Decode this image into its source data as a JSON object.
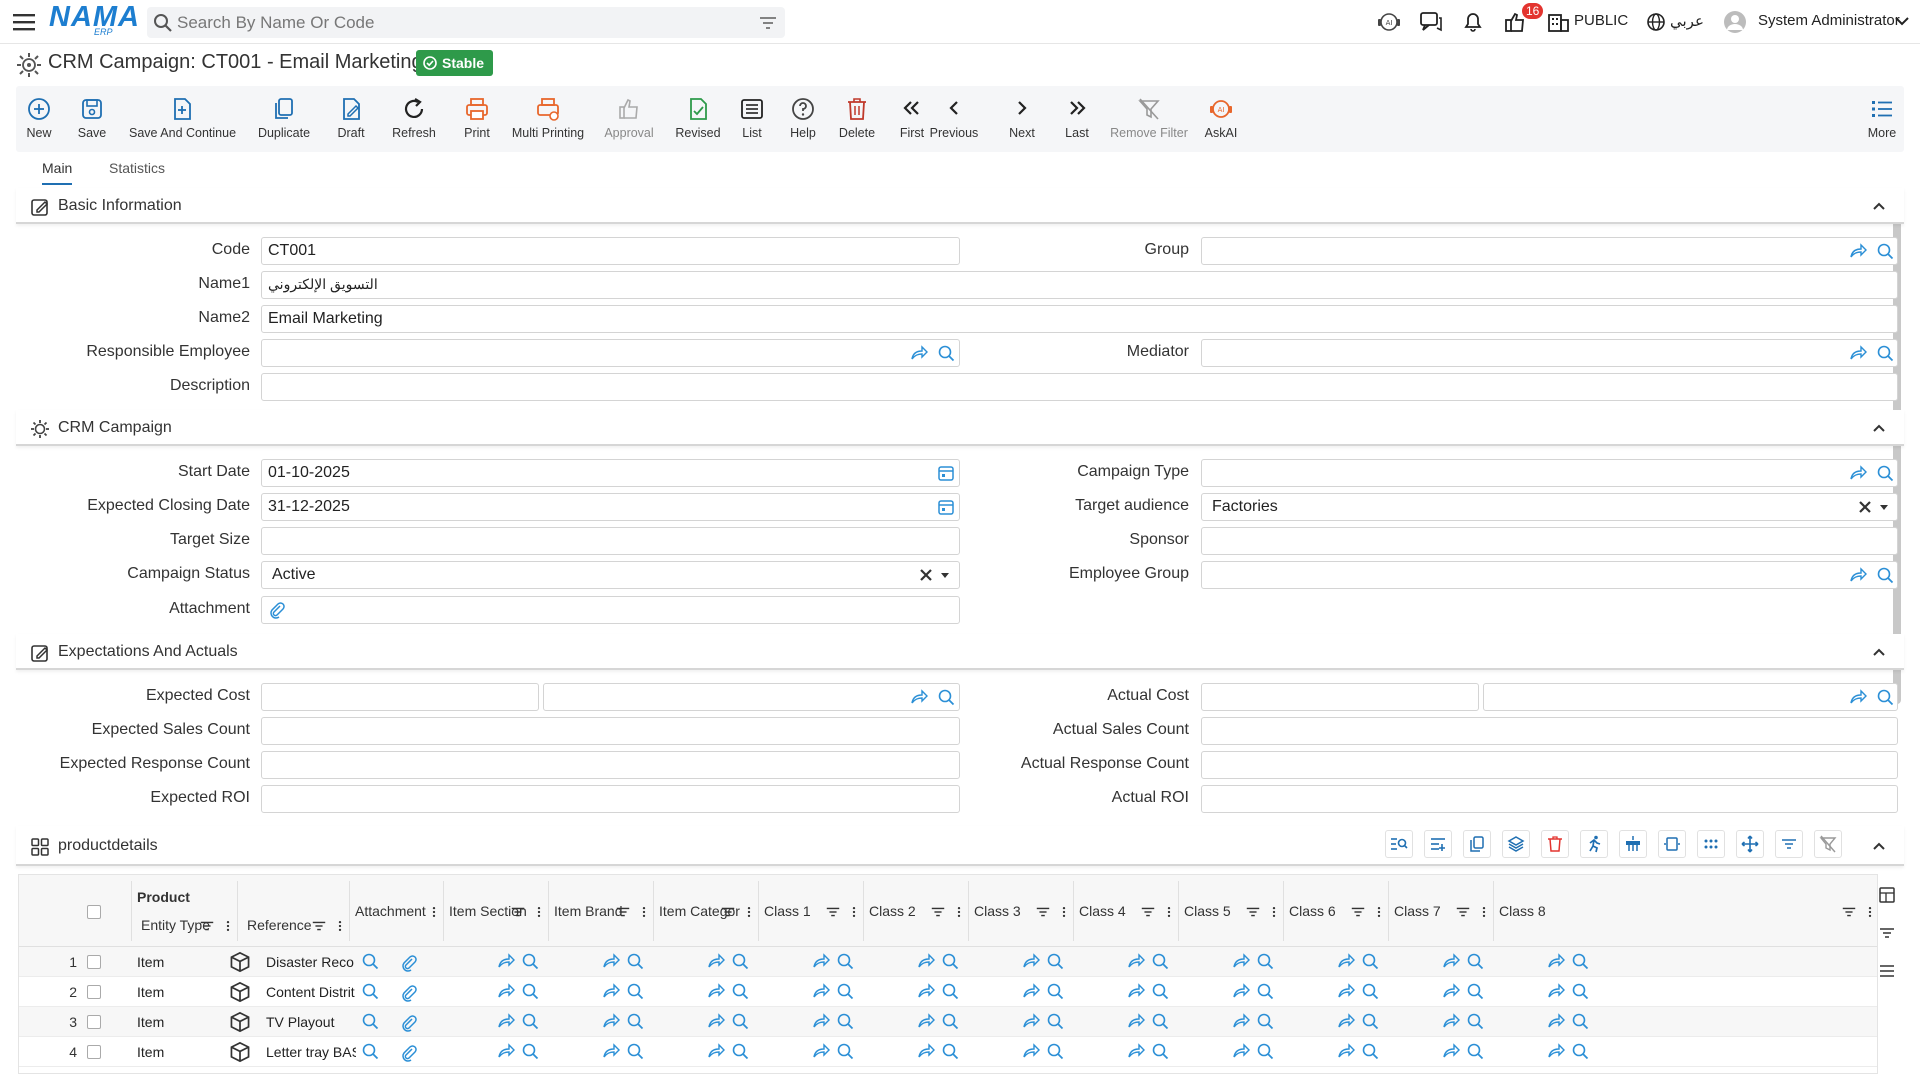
{
  "app": {
    "logo_text": "NAMA",
    "logo_sub": "ERP",
    "search_placeholder": "Search By Name Or Code",
    "notification_count": "16",
    "branch": "PUBLIC",
    "language": "عربي",
    "user": "System Administrator"
  },
  "page": {
    "title": "CRM Campaign: CT001 - Email Marketing",
    "status": "Stable"
  },
  "toolbar": {
    "new": "New",
    "save": "Save",
    "save_continue": "Save And Continue",
    "duplicate": "Duplicate",
    "draft": "Draft",
    "refresh": "Refresh",
    "print": "Print",
    "multi_printing": "Multi Printing",
    "approval": "Approval",
    "revised": "Revised",
    "list": "List",
    "help": "Help",
    "delete": "Delete",
    "first": "First",
    "previous": "Previous",
    "next": "Next",
    "last": "Last",
    "remove_filter": "Remove Filter",
    "askai": "AskAI",
    "more": "More"
  },
  "tabs": {
    "main": "Main",
    "statistics": "Statistics"
  },
  "basic": {
    "title": "Basic Information",
    "code_label": "Code",
    "code": "CT001",
    "group_label": "Group",
    "name1_label": "Name1",
    "name1": "التسويق الإلكتروني",
    "name2_label": "Name2",
    "name2": "Email Marketing",
    "resp_label": "Responsible Employee",
    "mediator_label": "Mediator",
    "desc_label": "Description"
  },
  "campaign": {
    "title": "CRM Campaign",
    "start_label": "Start Date",
    "start": "01-10-2025",
    "type_label": "Campaign Type",
    "closing_label": "Expected Closing Date",
    "closing": "31-12-2025",
    "audience_label": "Target audience",
    "audience": "Factories",
    "size_label": "Target Size",
    "sponsor_label": "Sponsor",
    "status_label": "Campaign Status",
    "status": "Active",
    "empgroup_label": "Employee Group",
    "attach_label": "Attachment"
  },
  "expect": {
    "title": "Expectations And Actuals",
    "exp_cost": "Expected Cost",
    "act_cost": "Actual Cost",
    "exp_sales": "Expected Sales Count",
    "act_sales": "Actual Sales Count",
    "exp_resp": "Expected Response Count",
    "act_resp": "Actual Response Count",
    "exp_roi": "Expected ROI",
    "act_roi": "Actual ROI"
  },
  "grid": {
    "title": "productdetails",
    "group_header": "Product",
    "columns": [
      "Entity Type",
      "Reference",
      "Attachment",
      "Item Section",
      "Item Brand",
      "Item Categor",
      "Class 1",
      "Class 2",
      "Class 3",
      "Class 4",
      "Class 5",
      "Class 6",
      "Class 7",
      "Class 8"
    ],
    "rows": [
      {
        "num": "1",
        "type": "Item",
        "ref": "Disaster Reco"
      },
      {
        "num": "2",
        "type": "Item",
        "ref": "Content Distrit"
      },
      {
        "num": "3",
        "type": "Item",
        "ref": "TV Playout"
      },
      {
        "num": "4",
        "type": "Item",
        "ref": "Letter tray BAS"
      }
    ]
  },
  "colors": {
    "accent": "#1f6fb2",
    "link_icon": "#2b8fd6",
    "status": "#2e9a4a",
    "danger": "#e3342f",
    "print": "#e8672c"
  }
}
